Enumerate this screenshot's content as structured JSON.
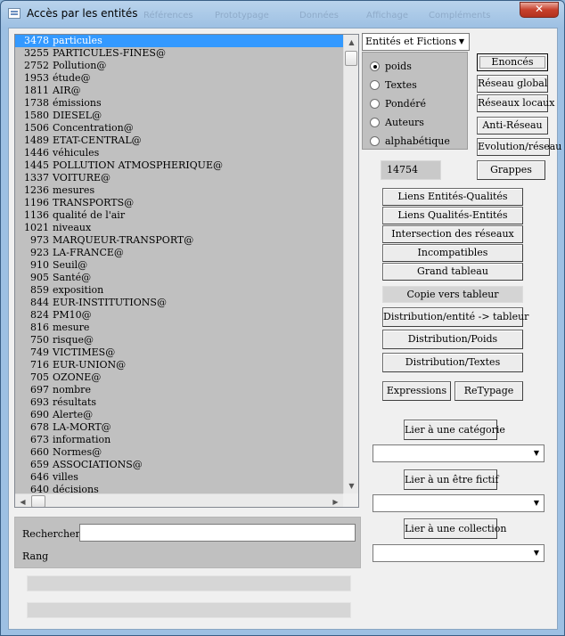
{
  "window": {
    "title": "Accès par les entités",
    "close_glyph": "✕",
    "background_tabs": [
      "Références",
      "Prototypage",
      "Données",
      "Affichage",
      "Compléments"
    ]
  },
  "entity_list": {
    "items": [
      {
        "count": "3478",
        "label": "particules",
        "selected": true
      },
      {
        "count": "3255",
        "label": "PARTICULES-FINES@"
      },
      {
        "count": "2752",
        "label": "Pollution@"
      },
      {
        "count": "1953",
        "label": "étude@"
      },
      {
        "count": "1811",
        "label": "AIR@"
      },
      {
        "count": "1738",
        "label": "émissions"
      },
      {
        "count": "1580",
        "label": "DIESEL@"
      },
      {
        "count": "1506",
        "label": "Concentration@"
      },
      {
        "count": "1489",
        "label": "ETAT-CENTRAL@"
      },
      {
        "count": "1446",
        "label": "véhicules"
      },
      {
        "count": "1445",
        "label": "POLLUTION ATMOSPHERIQUE@"
      },
      {
        "count": "1337",
        "label": "VOITURE@"
      },
      {
        "count": "1236",
        "label": "mesures"
      },
      {
        "count": "1196",
        "label": "TRANSPORTS@"
      },
      {
        "count": "1136",
        "label": "qualité de l'air"
      },
      {
        "count": "1021",
        "label": "niveaux"
      },
      {
        "count": "973",
        "label": "MARQUEUR-TRANSPORT@"
      },
      {
        "count": "923",
        "label": "LA-FRANCE@"
      },
      {
        "count": "910",
        "label": "Seuil@"
      },
      {
        "count": "905",
        "label": "Santé@"
      },
      {
        "count": "859",
        "label": "exposition"
      },
      {
        "count": "844",
        "label": "EUR-INSTITUTIONS@"
      },
      {
        "count": "824",
        "label": "PM10@"
      },
      {
        "count": "816",
        "label": "mesure"
      },
      {
        "count": "750",
        "label": "risque@"
      },
      {
        "count": "749",
        "label": "VICTIMES@"
      },
      {
        "count": "716",
        "label": "EUR-UNION@"
      },
      {
        "count": "705",
        "label": "OZONE@"
      },
      {
        "count": "697",
        "label": "nombre"
      },
      {
        "count": "693",
        "label": "résultats"
      },
      {
        "count": "690",
        "label": "Alerte@"
      },
      {
        "count": "678",
        "label": "LA-MORT@"
      },
      {
        "count": "673",
        "label": "information"
      },
      {
        "count": "660",
        "label": "Normes@"
      },
      {
        "count": "659",
        "label": "ASSOCIATIONS@"
      },
      {
        "count": "646",
        "label": "villes"
      },
      {
        "count": "640",
        "label": "décisions"
      }
    ],
    "scroll_up_glyph": "▲",
    "scroll_down_glyph": "▼",
    "scroll_left_glyph": "◀",
    "scroll_right_glyph": "▶"
  },
  "search": {
    "label": "Rechercher",
    "value": "",
    "rank_label": "Rang"
  },
  "type_select": {
    "value": "Entités et Fictions",
    "arrow": "▼"
  },
  "sort_options": [
    {
      "label": "poids",
      "checked": true
    },
    {
      "label": "Textes",
      "checked": false
    },
    {
      "label": "Pondéré",
      "checked": false
    },
    {
      "label": "Auteurs",
      "checked": false
    },
    {
      "label": "alphabétique",
      "checked": false
    }
  ],
  "count_value": "14754",
  "side_buttons": {
    "enonces": "Enoncés",
    "reseau_global": "Réseau global",
    "reseaux_locaux": "Réseaux locaux",
    "anti_reseau": "Anti-Réseau",
    "evolution_reseau": "Evolution/réseau",
    "grappes": "Grappes"
  },
  "main_buttons": {
    "liens_entites_qualites": "Liens Entités-Qualités",
    "liens_qualites_entites": "Liens Qualités-Entités",
    "intersection_reseaux": "Intersection des réseaux",
    "incompatibles": "Incompatibles",
    "grand_tableau": "Grand tableau",
    "copie_tableur": "Copie vers tableur",
    "distribution_entite_tableur": "Distribution/entité -> tableur",
    "distribution_poids": "Distribution/Poids",
    "distribution_textes": "Distribution/Textes",
    "expressions": "Expressions",
    "retypage": "ReTypage"
  },
  "link_sections": [
    {
      "button": "Lier à une catégorie",
      "select_value": ""
    },
    {
      "button": "Lier à un être fictif",
      "select_value": ""
    },
    {
      "button": "Lier à une collection",
      "select_value": ""
    }
  ],
  "dropdown_arrow": "▼"
}
